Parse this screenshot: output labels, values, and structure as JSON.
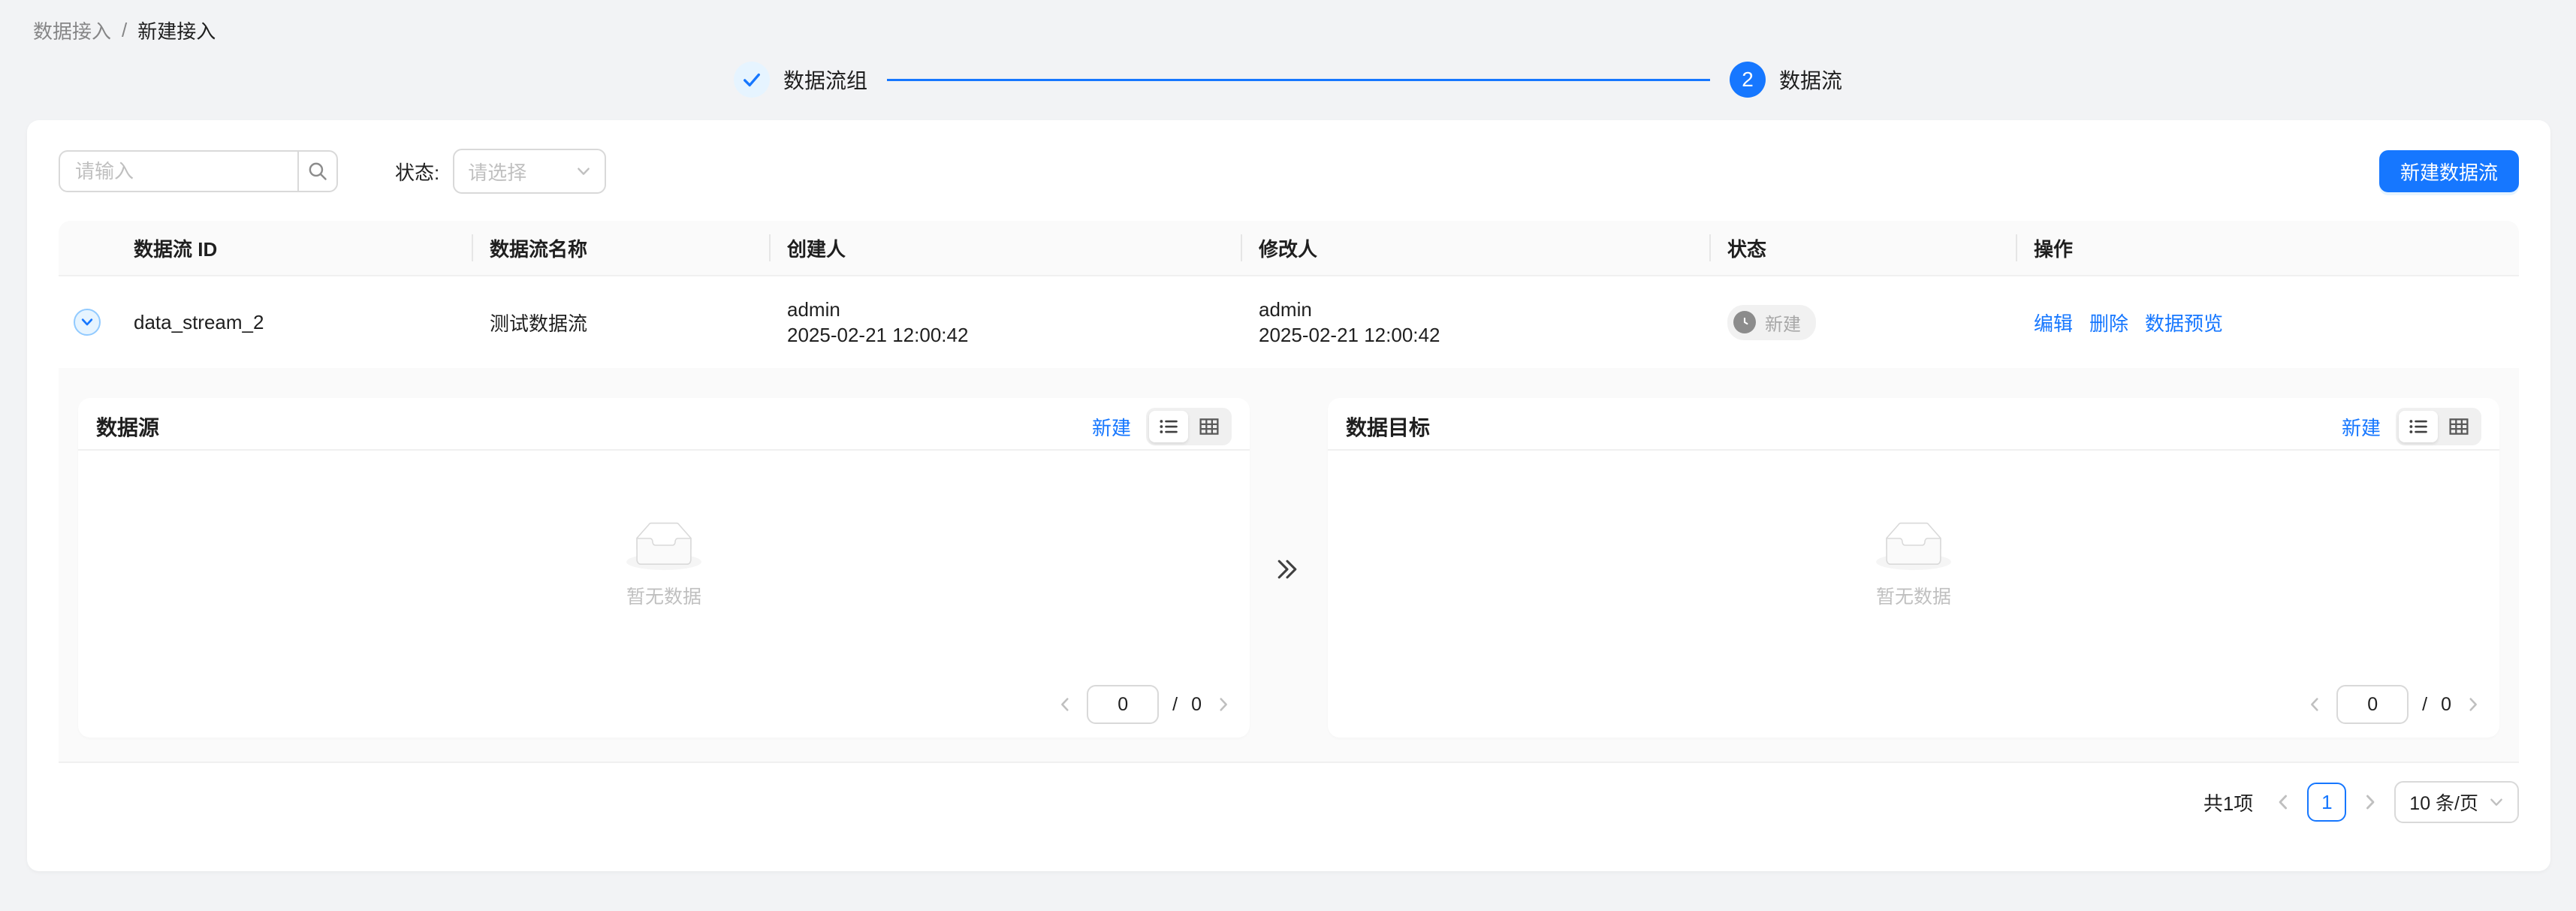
{
  "breadcrumb": {
    "parent": "数据接入",
    "separator": "/",
    "current": "新建接入"
  },
  "steps": {
    "step1": {
      "label": "数据流组"
    },
    "step2": {
      "number": "2",
      "label": "数据流"
    }
  },
  "toolbar": {
    "search_placeholder": "请输入",
    "status_label": "状态:",
    "status_placeholder": "请选择",
    "new_button": "新建数据流"
  },
  "table": {
    "columns": [
      "数据流 ID",
      "数据流名称",
      "创建人",
      "修改人",
      "状态",
      "操作"
    ],
    "rows": [
      {
        "id": "data_stream_2",
        "name": "测试数据流",
        "creator": "admin",
        "created_at": "2025-02-21 12:00:42",
        "modifier": "admin",
        "modified_at": "2025-02-21 12:00:42",
        "status": "新建",
        "actions": [
          "编辑",
          "删除",
          "数据预览"
        ]
      }
    ]
  },
  "panels": [
    {
      "title": "数据源",
      "new_link": "新建",
      "empty_text": "暂无数据",
      "page_current": "0",
      "page_sep": "/",
      "page_total": "0"
    },
    {
      "title": "数据目标",
      "new_link": "新建",
      "empty_text": "暂无数据",
      "page_current": "0",
      "page_sep": "/",
      "page_total": "0"
    }
  ],
  "footer": {
    "total_text": "共1项",
    "current_page": "1",
    "page_size": "10 条/页"
  },
  "colors": {
    "primary": "#1677ff",
    "header_bg": "#fafafa",
    "page_bg": "#f2f3f5",
    "badge_bg": "#f1f1f1",
    "badge_icon": "#8c8c8c"
  }
}
